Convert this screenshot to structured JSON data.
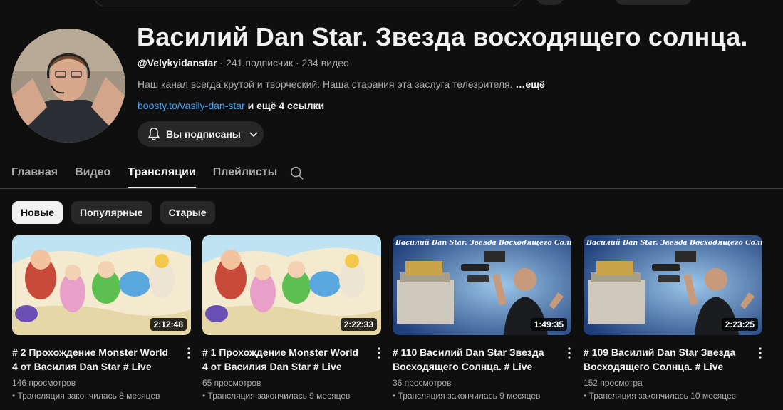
{
  "channel": {
    "title": "Василий Dan Star. Звезда восходящего солнца.",
    "handle": "@Velykyidanstar",
    "stats": " · 241 подписчик · 234 видео",
    "description": "Наш канал всегда крутой и творческий. Наша старания эта заслуга телезрителя.",
    "description_more": " …ещё",
    "link": "boosty.to/vasily-dan-star",
    "more_links": " и ещё 4 ссылки",
    "subscribe_label": "Вы подписаны"
  },
  "tabs": [
    {
      "label": "Главная"
    },
    {
      "label": "Видео"
    },
    {
      "label": "Трансляции",
      "active": true
    },
    {
      "label": "Плейлисты"
    }
  ],
  "chips": [
    {
      "label": "Новые",
      "active": true
    },
    {
      "label": "Популярные"
    },
    {
      "label": "Старые"
    }
  ],
  "videos": [
    {
      "title": "# 2 Прохождение Monster World 4 от Василия Dan Star # Live",
      "duration": "2:12:48",
      "views": "146 просмотров",
      "ended": "• Трансляция закончилась 8 месяцев",
      "thumb": "monster-world"
    },
    {
      "title": "# 1 Прохождение Monster World 4 от Василия Dan Star # Live",
      "duration": "2:22:33",
      "views": "65 просмотров",
      "ended": "• Трансляция закончилась 9 месяцев",
      "thumb": "monster-world"
    },
    {
      "title": "# 110 Василий Dan Star Звезда Восходящего Солнца. # Live",
      "duration": "1:49:35",
      "views": "36 просмотров",
      "ended": "• Трансляция закончилась 9 месяцев",
      "thumb": "stream-host",
      "thumb_caption": "Василий  Dan Star. Звезда Восходящего Солнца. # Live"
    },
    {
      "title": "# 109 Василий Dan Star Звезда Восходящего Солнца. # Live",
      "duration": "2:23:25",
      "views": "152 просмотра",
      "ended": "• Трансляция закончилась 10 месяцев",
      "thumb": "stream-host",
      "thumb_caption": "Василий  Dan Star. Звезда Восходящего Солнца. # Live"
    }
  ],
  "colors": {
    "background": "#0f0f0f",
    "link": "#3ea6ff",
    "chip": "#272727"
  }
}
